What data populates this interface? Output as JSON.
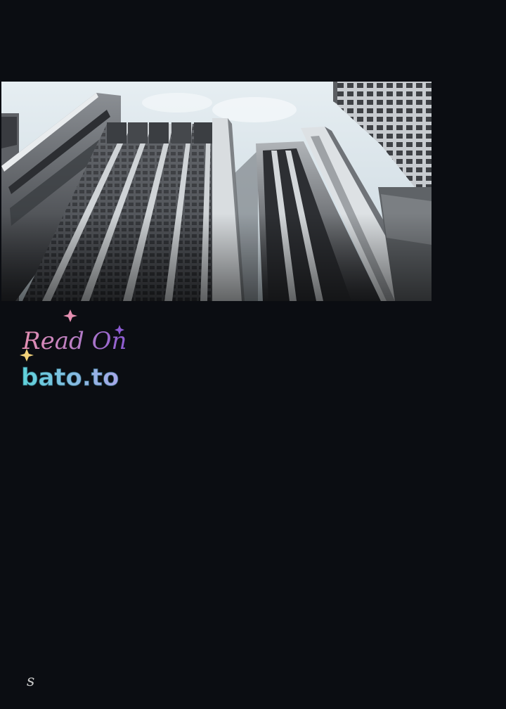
{
  "colors": {
    "background": "#0b0d12",
    "sky": "#dfe8ee",
    "watermark_pink": "#e58fb1",
    "watermark_purple": "#8d5bd3",
    "watermark_teal": "#5ed3da",
    "star_gold": "#f3d27a"
  },
  "panel": {
    "image_subject": "low-angle view of high-rise office buildings against the sky"
  },
  "watermark": {
    "line1": "Read On",
    "line2": "bato.to"
  },
  "page_mark": "s"
}
